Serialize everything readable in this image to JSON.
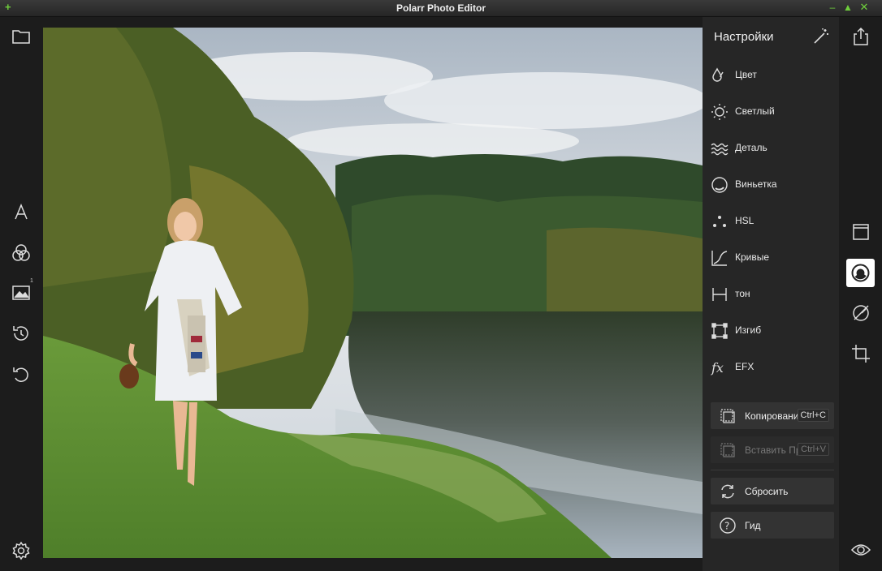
{
  "window": {
    "title": "Polarr Photo Editor"
  },
  "left_toolbar": {
    "badge": "1"
  },
  "panel": {
    "title": "Настройки",
    "items": [
      {
        "label": "Цвет",
        "icon": "drops-icon"
      },
      {
        "label": "Светлый",
        "icon": "sun-icon"
      },
      {
        "label": "Деталь",
        "icon": "waves-icon"
      },
      {
        "label": "Виньетка",
        "icon": "vignette-icon"
      },
      {
        "label": "HSL",
        "icon": "dots-icon"
      },
      {
        "label": "Кривые",
        "icon": "curve-icon"
      },
      {
        "label": "тон",
        "icon": "tone-icon"
      },
      {
        "label": "Изгиб",
        "icon": "distortion-icon"
      },
      {
        "label": "EFX",
        "icon": "fx-icon"
      }
    ],
    "copy": {
      "label": "Копирование",
      "shortcut": "Ctrl+C"
    },
    "paste": {
      "label": "Вставить Правки",
      "shortcut": "Ctrl+V"
    },
    "reset": {
      "label": "Сбросить"
    },
    "guide": {
      "label": "Гид"
    }
  }
}
